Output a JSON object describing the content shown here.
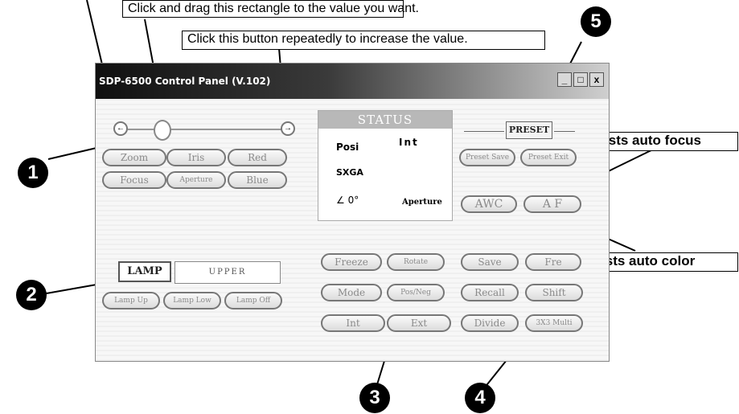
{
  "callouts": {
    "drag": "Click and drag this rectangle to the value you want.",
    "click": "Click this button repeatedly to increase the value.",
    "focus": "Adjusts auto focus",
    "color": "Adjusts auto color"
  },
  "badges": [
    "1",
    "2",
    "3",
    "4",
    "5"
  ],
  "window": {
    "title": "SDP-6500 Control Panel (V.102)",
    "controls": {
      "minimize": "_",
      "maximize": "□",
      "close": "x"
    }
  },
  "slider": {
    "left_arrow": "←",
    "right_arrow": "→"
  },
  "group1": {
    "buttons": [
      "Zoom",
      "Iris",
      "Red",
      "Focus",
      "Aperture",
      "Blue"
    ]
  },
  "lamp": {
    "label": "LAMP",
    "field_value": "UPPER",
    "buttons": [
      "Lamp Up",
      "Lamp Low",
      "Lamp Off"
    ]
  },
  "status": {
    "title": "STATUS",
    "posi": "Posi",
    "int": "Int",
    "res": "SXGA",
    "angle": "∠ 0°",
    "aperture": "Aperture"
  },
  "preset": {
    "label": "PRESET",
    "buttons": [
      "Preset Save",
      "Preset Exit"
    ]
  },
  "auto": {
    "awc": "AWC",
    "af": "A F"
  },
  "group3": {
    "buttons": [
      "Freeze",
      "Rotate",
      "Mode",
      "Pos/Neg",
      "Int",
      "Ext"
    ]
  },
  "group4": {
    "buttons": [
      "Save",
      "Fre",
      "Recall",
      "Shift",
      "Divide",
      "3X3 Multi"
    ]
  }
}
